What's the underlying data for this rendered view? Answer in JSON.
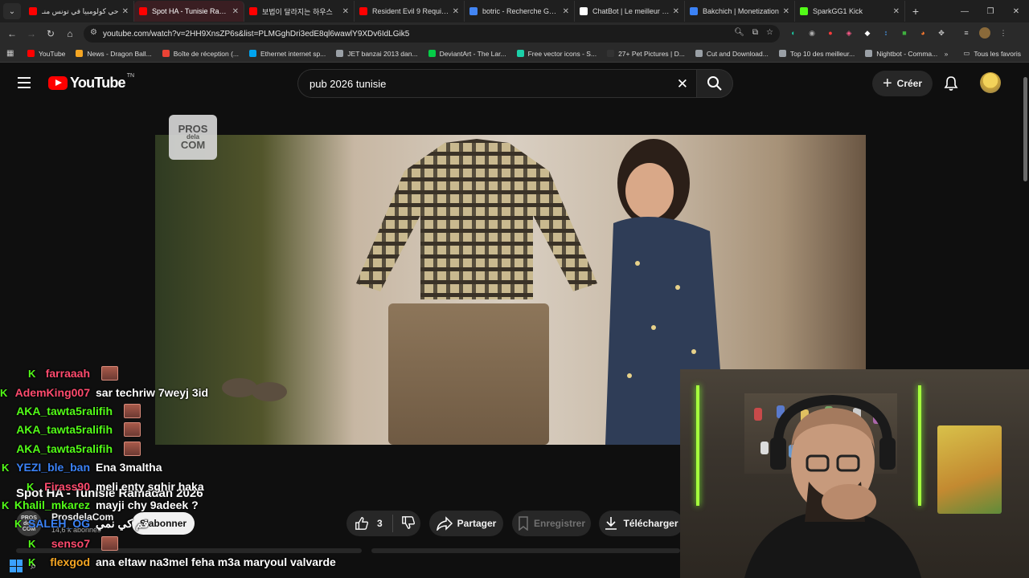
{
  "browser": {
    "tabs": [
      {
        "title": "حي كولومبيا في تونس منـ",
        "favicon_color": "#ff0000",
        "active": false
      },
      {
        "title": "Spot HA - Tunisie Ramad",
        "favicon_color": "#ff0000",
        "active": true
      },
      {
        "title": "보법이 달라지는 하우스",
        "favicon_color": "#ff0000",
        "active": false
      },
      {
        "title": "Resident Evil 9 Requiem",
        "favicon_color": "#ff0000",
        "active": false
      },
      {
        "title": "botric - Recherche Googl",
        "favicon_color": "#4285f4",
        "active": false
      },
      {
        "title": "ChatBot | Le meilleur log",
        "favicon_color": "#ffffff",
        "active": false
      },
      {
        "title": "Bakchich | Monetization",
        "favicon_color": "#3b82f6",
        "active": false
      },
      {
        "title": "SparkGG1 Kick",
        "favicon_color": "#53fc18",
        "active": false
      }
    ],
    "new_tab_icon": "plus-icon",
    "url": "youtube.com/watch?v=2HH9XnsZP6s&list=PLMGghDri3edE8ql6wawlY9XDv6IdLGik5",
    "bookmarks": [
      {
        "label": "YouTube",
        "color": "#ff0000"
      },
      {
        "label": "News - Dragon Ball...",
        "color": "#f5a623"
      },
      {
        "label": "Boîte de réception (...",
        "color": "#ea4335"
      },
      {
        "label": "Ethernet internet sp...",
        "color": "#00a4ef"
      },
      {
        "label": "JET banzai 2013 dan...",
        "color": "#9aa0a6"
      },
      {
        "label": "DeviantArt - The Lar...",
        "color": "#05cc47"
      },
      {
        "label": "Free vector icons - S...",
        "color": "#1bd0a8"
      },
      {
        "label": "27+ Pet Pictures | D...",
        "color": "#333333"
      },
      {
        "label": "Cut and Download...",
        "color": "#9aa0a6"
      },
      {
        "label": "Top 10 des meilleur...",
        "color": "#9aa0a6"
      },
      {
        "label": "Nightbot - Comma...",
        "color": "#9aa0a6"
      }
    ],
    "all_bookmarks_label": "Tous les favoris"
  },
  "youtube": {
    "logo_text": "YouTube",
    "logo_country": "TN",
    "search_value": "pub 2026 tunisie",
    "create_label": "Créer",
    "video": {
      "watermark_line1": "PROS",
      "watermark_line2": "dela",
      "watermark_line3": "COM",
      "title": "Spot HA - Tunisie Ramadan 2026"
    },
    "channel": {
      "name": "ProsdelaCom",
      "subscribers": "14,6 k abonnés",
      "avatar_line1": "PROS",
      "avatar_line2": "dela",
      "avatar_line3": "COM"
    },
    "subscribe_label": "S'abonner",
    "like_count": "3",
    "share_label": "Partager",
    "save_label": "Enregistrer",
    "download_label": "Télécharger"
  },
  "chat": {
    "platform_badge": "K",
    "messages": [
      {
        "user": "farraaah",
        "color": "#ff4b6e",
        "message": "",
        "emote": true
      },
      {
        "user": "AdemKing007",
        "color": "#ff4b6e",
        "message": "sar techriw 7weyj 3id",
        "emote": false
      },
      {
        "user": "AKA_tawta5ralifih",
        "color": "#53fc18",
        "message": "",
        "emote": true
      },
      {
        "user": "AKA_tawta5ralifih",
        "color": "#53fc18",
        "message": "",
        "emote": true
      },
      {
        "user": "AKA_tawta5ralifih",
        "color": "#53fc18",
        "message": "",
        "emote": true
      },
      {
        "user": "YEZI_ble_ban",
        "color": "#3b82f6",
        "message": "Ena 3maltha",
        "emote": false
      },
      {
        "user": "Firass90",
        "color": "#ff4b6e",
        "message": "meli enty sghir haka",
        "emote": false
      },
      {
        "user": "Khalil_mkarez",
        "color": "#53fc18",
        "message": "mayji chy 9adeek ?",
        "emote": false
      },
      {
        "user": "SALEH_OG",
        "color": "#3b82f6",
        "message": "قم كي نمي",
        "emote": false
      },
      {
        "user": "senso7",
        "color": "#ff4b6e",
        "message": "",
        "emote": true
      },
      {
        "user": "flexgod",
        "color": "#f5a623",
        "message": "ana eltaw na3mel feha m3a maryoul valvarde",
        "emote": false
      }
    ]
  }
}
